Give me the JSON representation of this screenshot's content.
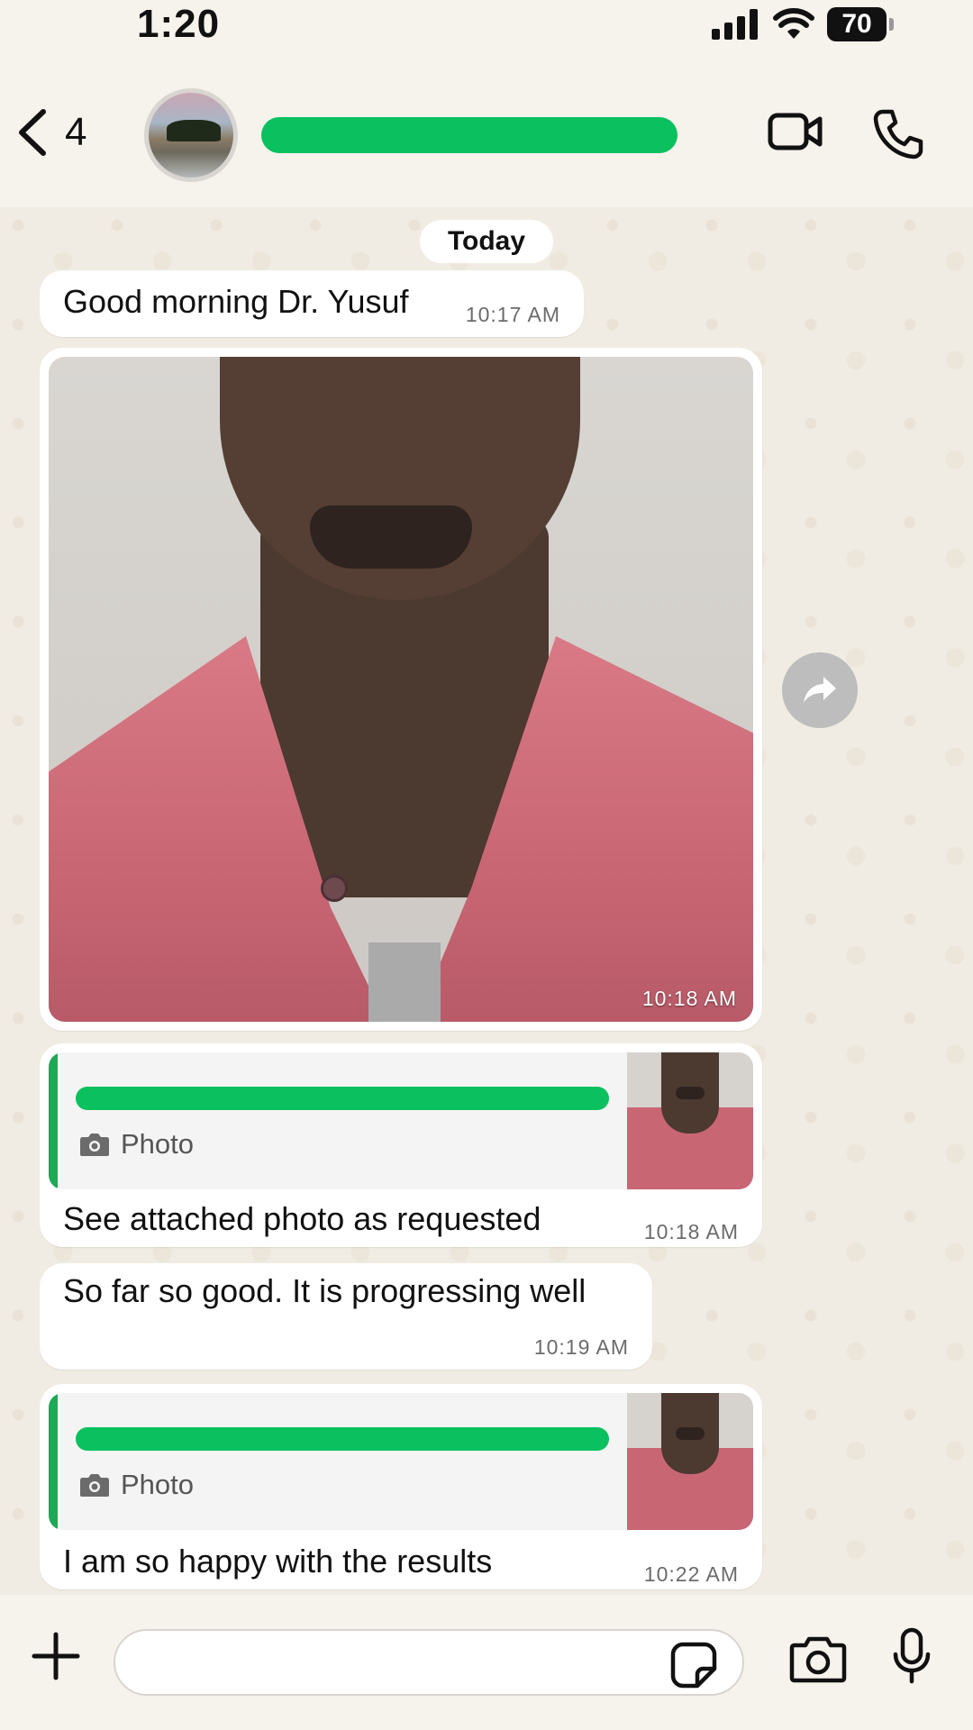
{
  "status_bar": {
    "time": "1:20",
    "battery": "70"
  },
  "header": {
    "back_count": "4"
  },
  "chat": {
    "date_label": "Today",
    "messages": [
      {
        "text": "Good morning Dr. Yusuf",
        "time": "10:17 AM"
      },
      {
        "type": "photo",
        "time": "10:18 AM"
      },
      {
        "reply_label": "Photo",
        "text": "See attached photo as requested",
        "time": "10:18 AM"
      },
      {
        "text": "So far so good. It is progressing well",
        "time": "10:19 AM"
      },
      {
        "reply_label": "Photo",
        "text": "I am so happy with the results",
        "time": "10:22 AM"
      }
    ]
  },
  "colors": {
    "redaction": "#0ac05f",
    "reply_bar": "#1fa855",
    "background": "#f6f2ec"
  },
  "icons": [
    "back-chevron-icon",
    "video-call-icon",
    "phone-icon",
    "forward-icon",
    "camera-small-icon",
    "plus-icon",
    "sticker-icon",
    "camera-icon",
    "microphone-icon"
  ]
}
